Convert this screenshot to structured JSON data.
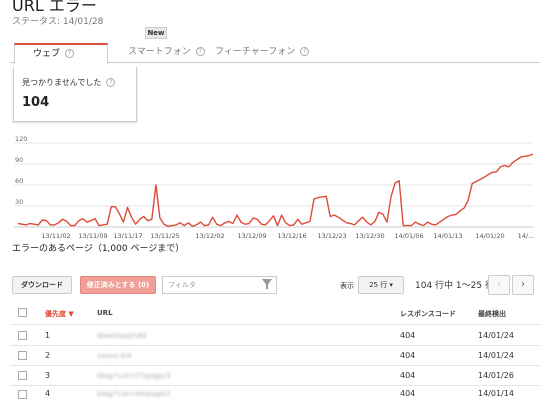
{
  "header": {
    "title": "URL エラー",
    "status": "ステータス: 14/01/28",
    "new_badge": "New"
  },
  "tabs": [
    {
      "label": "ウェブ",
      "active": true
    },
    {
      "label": "スマートフォン",
      "active": false
    },
    {
      "label": "フィーチャーフォン",
      "active": false
    }
  ],
  "summary_card": {
    "label": "見つかりませんでした",
    "value": "104"
  },
  "chart_data": {
    "type": "line",
    "color": "#dd4b39",
    "ylim": [
      0,
      120
    ],
    "y_ticks": [
      "120",
      "90",
      "60",
      "30"
    ],
    "x_ticks": [
      "13/11/02",
      "13/11/09",
      "13/11/17",
      "13/11/25",
      "13/12/02",
      "13/12/09",
      "13/12/16",
      "13/12/23",
      "13/12/30",
      "14/01/06",
      "14/01/13",
      "14/01/20",
      "14/..."
    ],
    "values": [
      5,
      4,
      3,
      5,
      4,
      3,
      10,
      9,
      3,
      3,
      6,
      11,
      8,
      2,
      2,
      9,
      12,
      7,
      9,
      12,
      2,
      3,
      4,
      29,
      29,
      19,
      7,
      28,
      14,
      4,
      11,
      15,
      9,
      11,
      60,
      13,
      4,
      1,
      2,
      3,
      6,
      2,
      6,
      1,
      3,
      7,
      2,
      3,
      14,
      4,
      2,
      6,
      8,
      5,
      17,
      7,
      4,
      5,
      13,
      11,
      4,
      3,
      9,
      16,
      2,
      17,
      6,
      2,
      3,
      11,
      4,
      6,
      8,
      40,
      42,
      43,
      44,
      15,
      17,
      14,
      10,
      6,
      5,
      3,
      9,
      14,
      7,
      3,
      8,
      21,
      18,
      7,
      44,
      63,
      66,
      2,
      2,
      2,
      7,
      4,
      2,
      7,
      4,
      3,
      7,
      11,
      15,
      17,
      18,
      23,
      27,
      38,
      62,
      65,
      68,
      71,
      75,
      78,
      79,
      86,
      88,
      86,
      92,
      96,
      100,
      101,
      102,
      104
    ]
  },
  "errors_section": {
    "title": "エラーのあるページ（1,000 ページまで）",
    "download_label": "ダウンロード",
    "mark_fixed_label": "修正済みとする (0)",
    "filter_placeholder": "フィルタ",
    "show_label": "表示",
    "rows_select": "25 行 ▾",
    "range_text": "104 行中 1〜25 行",
    "prev": "‹",
    "next": "›"
  },
  "table": {
    "headers": [
      "優先度 ▼",
      "URL",
      "レスポンスコード",
      "最終検出"
    ],
    "rows": [
      {
        "priority": "1",
        "url": "download/180",
        "code": "404",
        "date": "14/01/24"
      },
      {
        "priority": "2",
        "url": "xxxxx-4/4",
        "code": "404",
        "date": "14/01/24"
      },
      {
        "priority": "3",
        "url": "blog/?cat=27/page/3",
        "code": "404",
        "date": "14/01/26"
      },
      {
        "priority": "4",
        "url": "blog/?cat=34/page/2",
        "code": "404",
        "date": "14/01/14"
      }
    ]
  }
}
